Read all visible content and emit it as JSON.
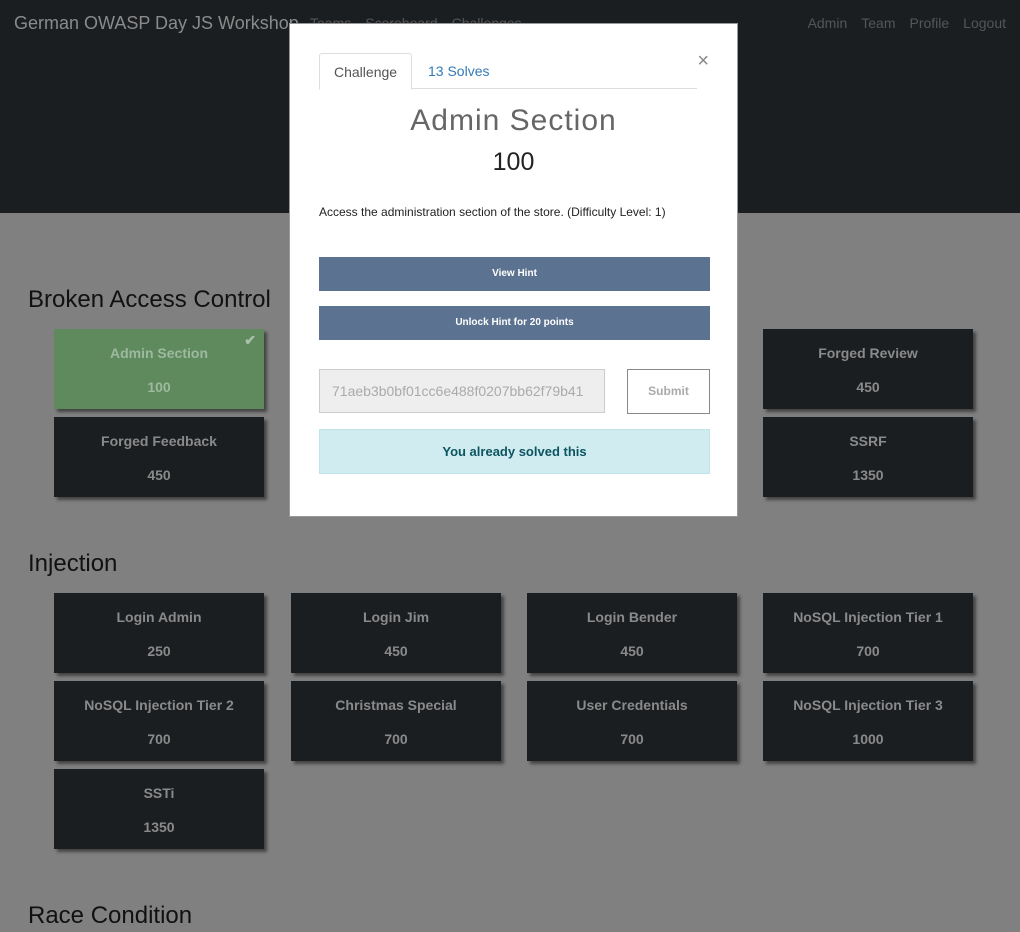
{
  "navbar": {
    "brand": "German OWASP Day JS Workshop",
    "left": [
      "Teams",
      "Scoreboard",
      "Challenges"
    ],
    "right": [
      "Admin",
      "Team",
      "Profile",
      "Logout"
    ]
  },
  "categories": [
    {
      "name": "Broken Access Control",
      "cards": [
        {
          "name": "Admin Section",
          "points": "100",
          "solved": true
        },
        {
          "name": "Forged Review",
          "points": "450"
        },
        {
          "name": "Forged Feedback",
          "points": "450"
        },
        {
          "name": "SSRF",
          "points": "1350"
        }
      ]
    },
    {
      "name": "Injection",
      "cards": [
        {
          "name": "Login Admin",
          "points": "250"
        },
        {
          "name": "Login Jim",
          "points": "450"
        },
        {
          "name": "Login Bender",
          "points": "450"
        },
        {
          "name": "NoSQL Injection Tier 1",
          "points": "700"
        },
        {
          "name": "NoSQL Injection Tier 2",
          "points": "700"
        },
        {
          "name": "Christmas Special",
          "points": "700"
        },
        {
          "name": "User Credentials",
          "points": "700"
        },
        {
          "name": "NoSQL Injection Tier 3",
          "points": "1000"
        },
        {
          "name": "SSTi",
          "points": "1350"
        }
      ]
    },
    {
      "name": "Race Condition",
      "cards": []
    }
  ],
  "modal": {
    "tabs": [
      "Challenge",
      "13 Solves"
    ],
    "close": "×",
    "title": "Admin Section",
    "value": "100",
    "description": "Access the administration section of the store. (Difficulty Level: 1)",
    "view_hint": "View Hint",
    "unlock_hint": "Unlock Hint for 20 points",
    "flag_value": "71aeb3b0bf01cc6e488f0207bb62f79b41",
    "submit": "Submit",
    "status": "You already solved this"
  },
  "colors": {
    "solved": "#5e8a5e",
    "card": "#1b1e21",
    "hint_button": "#5b7290",
    "alert": "#d1ecf1"
  }
}
